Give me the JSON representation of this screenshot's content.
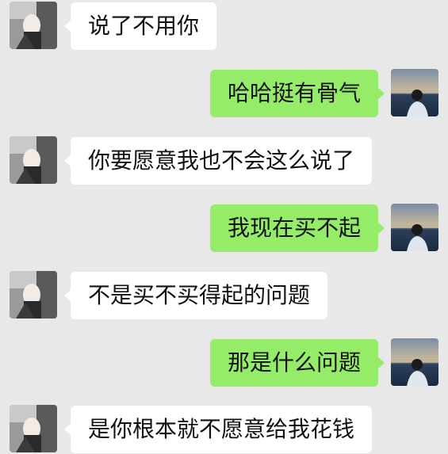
{
  "chat": {
    "messages": [
      {
        "side": "left",
        "text": "说了不用你"
      },
      {
        "side": "right",
        "text": "哈哈挺有骨气"
      },
      {
        "side": "left",
        "text": "你要愿意我也不会这么说了"
      },
      {
        "side": "right",
        "text": "我现在买不起"
      },
      {
        "side": "left",
        "text": "不是买不买得起的问题"
      },
      {
        "side": "right",
        "text": "那是什么问题"
      },
      {
        "side": "left",
        "text": "是你根本就不愿意给我花钱"
      }
    ]
  },
  "colors": {
    "background": "#e8e8e8",
    "incoming_bubble": "#ffffff",
    "outgoing_bubble": "#95ec69",
    "text": "#111111"
  },
  "icons": {
    "incoming_avatar": "contact-avatar-icon",
    "outgoing_avatar": "self-avatar-icon"
  }
}
